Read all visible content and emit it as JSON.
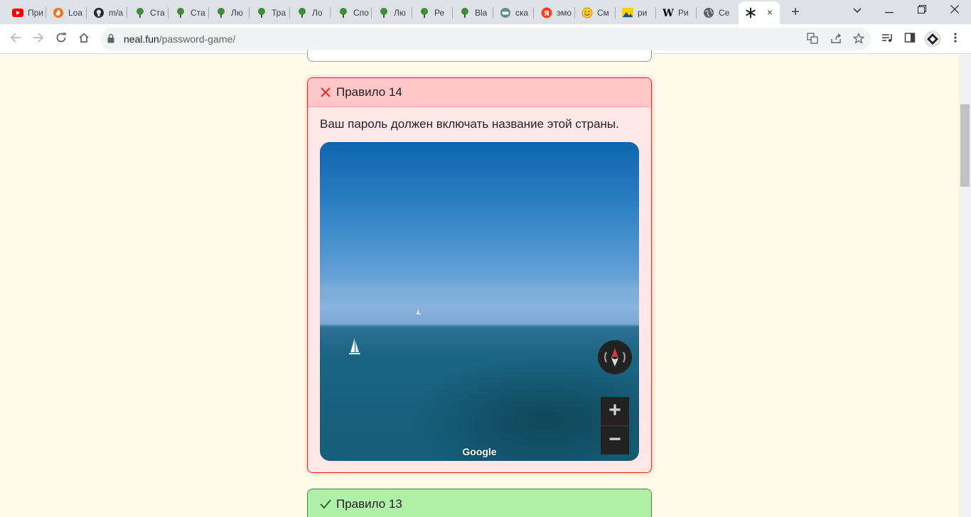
{
  "browser": {
    "tabs": [
      {
        "label": "При",
        "icon": "youtube-icon"
      },
      {
        "label": "Loa",
        "icon": "fire-icon"
      },
      {
        "label": "m/a",
        "icon": "github-icon"
      },
      {
        "label": "Ста",
        "icon": "tree-icon"
      },
      {
        "label": "Ста",
        "icon": "tree-icon"
      },
      {
        "label": "Лю",
        "icon": "tree-icon"
      },
      {
        "label": "Тра",
        "icon": "tree-icon"
      },
      {
        "label": "Ло",
        "icon": "tree-icon"
      },
      {
        "label": "Спо",
        "icon": "tree-icon"
      },
      {
        "label": "Лю",
        "icon": "tree-icon"
      },
      {
        "label": "Ре",
        "icon": "tree-icon"
      },
      {
        "label": "Bla",
        "icon": "tree-icon"
      },
      {
        "label": "ска",
        "icon": "gamepad-icon"
      },
      {
        "label": "эмо",
        "icon": "yandex-icon"
      },
      {
        "label": "См",
        "icon": "smiley-icon"
      },
      {
        "label": "ри",
        "icon": "image-icon"
      },
      {
        "label": "Ри",
        "icon": "wikipedia-icon"
      },
      {
        "label": "Се",
        "icon": "globe-icon"
      }
    ],
    "active_tab": {
      "icon": "asterisk-icon",
      "close": "×"
    },
    "new_tab": "+",
    "url_host": "neal.fun",
    "url_path": "/password-game/"
  },
  "rules": {
    "failed": {
      "title": "Правило 14",
      "text": "Ваш пароль должен включать название этой страны.",
      "map_logo": "Google",
      "zoom_in": "+",
      "zoom_out": "−"
    },
    "passed": {
      "title": "Правило 13"
    }
  },
  "colors": {
    "page_bg": "#fffae9",
    "fail_border": "#e52727",
    "fail_header": "#ffc8c8",
    "pass_header": "#b0f0a8"
  }
}
